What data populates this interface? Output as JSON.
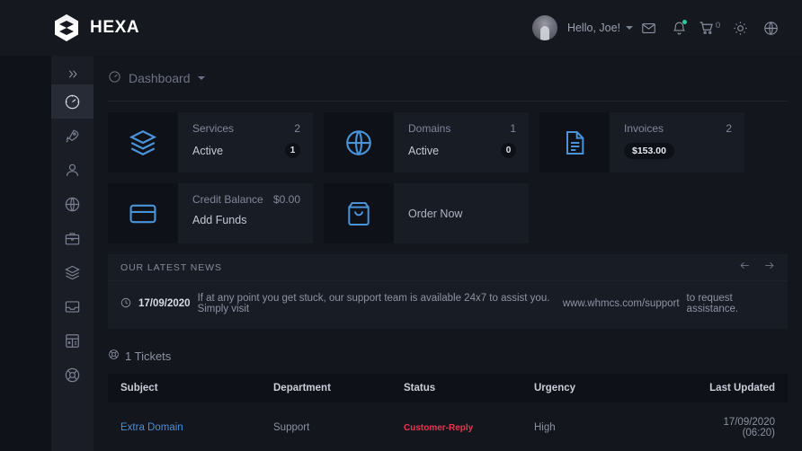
{
  "header": {
    "brand": "HEXA",
    "brand_icon": "hexagon-logo-icon",
    "user_greeting": "Hello, Joe!",
    "avatar_icon": "avatar",
    "mail_icon": "mail-icon",
    "bell_icon": "bell-icon",
    "cart_icon": "cart-icon",
    "cart_count": "0",
    "theme_icon": "sun-icon",
    "language_icon": "globe-icon"
  },
  "sidebar": {
    "collapse_icon": "chevron-double-right-icon",
    "items": [
      {
        "name": "dashboard",
        "icon": "speedometer-icon",
        "active": true
      },
      {
        "name": "services",
        "icon": "rocket-icon",
        "active": false
      },
      {
        "name": "account",
        "icon": "user-icon",
        "active": false
      },
      {
        "name": "domains",
        "icon": "globe-icon",
        "active": false
      },
      {
        "name": "store",
        "icon": "briefcase-icon",
        "active": false
      },
      {
        "name": "products",
        "icon": "layers-icon",
        "active": false
      },
      {
        "name": "tickets",
        "icon": "inbox-icon",
        "active": false
      },
      {
        "name": "billing",
        "icon": "grid-calculator-icon",
        "active": false
      },
      {
        "name": "support",
        "icon": "lifebuoy-icon",
        "active": false
      }
    ]
  },
  "breadcrumb": {
    "icon": "speedometer-icon",
    "label": "Dashboard",
    "caret_icon": "chevron-down-icon"
  },
  "cards": [
    {
      "icon": "layers-icon",
      "label": "Services",
      "count": "2",
      "sub_label": "Active",
      "badge": "1",
      "badge_type": "circle"
    },
    {
      "icon": "globe-icon",
      "label": "Domains",
      "count": "1",
      "sub_label": "Active",
      "badge": "0",
      "badge_type": "circle"
    },
    {
      "icon": "document-icon",
      "label": "Invoices",
      "count": "2",
      "sub_label": "",
      "badge": "$153.00",
      "badge_type": "pill"
    },
    {
      "icon": "credit-card-icon",
      "label": "Credit Balance",
      "count": "$0.00",
      "sub_label": "Add Funds",
      "badge": "",
      "badge_type": "none"
    },
    {
      "icon": "shopping-bag-icon",
      "label": "Order Now",
      "count": "",
      "sub_label": "",
      "badge": "",
      "badge_type": "action"
    }
  ],
  "news": {
    "title": "OUR LATEST NEWS",
    "prev_icon": "arrow-left-icon",
    "next_icon": "arrow-right-icon",
    "clock_icon": "clock-icon",
    "date": "17/09/2020",
    "text_before": "If at any point you get stuck, our support team is available 24x7 to assist you. Simply visit",
    "link": "www.whmcs.com/support",
    "text_after": "to request assistance."
  },
  "tickets": {
    "icon": "lifebuoy-icon",
    "heading": "1 Tickets",
    "columns": [
      "Subject",
      "Department",
      "Status",
      "Urgency",
      "Last Updated"
    ],
    "rows": [
      {
        "subject": "Extra Domain",
        "department": "Support",
        "status": "Customer-Reply",
        "urgency": "High",
        "last_updated": "17/09/2020 (06:20)"
      }
    ]
  },
  "colors": {
    "page_bg": "#13161d",
    "header_bg": "#15181f",
    "sidebar_bg": "#1a1d26",
    "card_bg": "#181c25",
    "card_icon_bg": "#0e1117",
    "accent_blue": "#4b93d8",
    "link_blue": "#4a8fd6",
    "status_red": "#e63950",
    "notify_green": "#2ecc9b"
  }
}
